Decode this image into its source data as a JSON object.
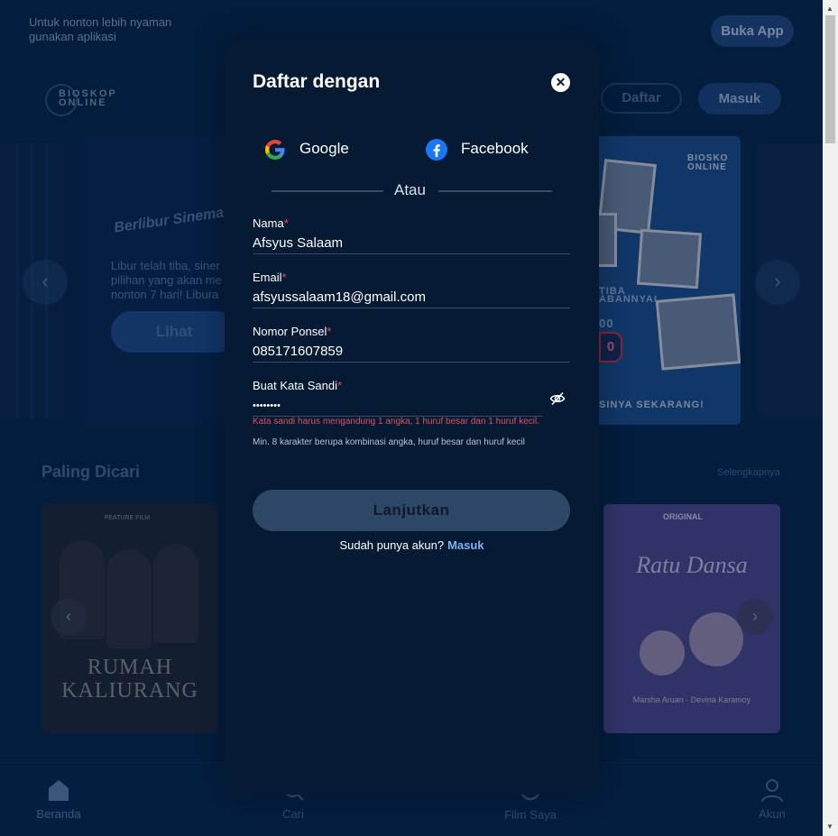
{
  "topbar": {
    "promo": "Untuk nonton lebih nyaman gunakan aplikasi",
    "open_app": "Buka App"
  },
  "header": {
    "logo_line1": "BIOSKOP",
    "logo_line2": "ONLINE",
    "register": "Daftar",
    "login": "Masuk"
  },
  "carousel": {
    "brand": "Berlibur Sinema",
    "description": "Libur telah tiba, siner pilihan yang akan me nonton 7 hari! Libura",
    "cta": "Lihat",
    "right_tag1": "TIBA",
    "right_tag2": "ABANNYAI",
    "right_footer": "SINYA SEKARANG!",
    "right_logo1": "BIOSKO",
    "right_logo2": "ONLINE",
    "right_sign": "0",
    "right_num": "00"
  },
  "section": {
    "title": "Paling Dicari",
    "more": "Selengkapnya"
  },
  "posters": [
    {
      "title": "RUMAH KALIURANG",
      "label": "FEATURE FILM"
    },
    {
      "title": "Ratu Dansa",
      "label": "ORIGINAL",
      "credits": "Marsha Aruan · Devina Karamoy"
    }
  ],
  "bottom_nav": [
    {
      "label": "Beranda",
      "icon": "home-icon",
      "active": true
    },
    {
      "label": "Cari",
      "icon": "search-icon",
      "active": false
    },
    {
      "label": "Film Saya",
      "icon": "film-icon",
      "active": false
    },
    {
      "label": "Akun",
      "icon": "user-icon",
      "active": false
    }
  ],
  "modal": {
    "title": "Daftar dengan",
    "google": "Google",
    "facebook": "Facebook",
    "or": "Atau",
    "fields": {
      "name": {
        "label": "Nama",
        "value": "Afsyus Salaam"
      },
      "email": {
        "label": "Email",
        "value": "afsyussalaam18@gmail.com"
      },
      "phone": {
        "label": "Nomor Ponsel",
        "value": "085171607859"
      },
      "password": {
        "label": "Buat Kata Sandi",
        "value": "••••••••"
      }
    },
    "required_mark": "*",
    "error": "Kata sandi harus mengandung 1 angka, 1 huruf besar dan 1 huruf kecil.",
    "hint": "Min. 8 karakter berupa kombinasi angka, huruf besar dan huruf kecil",
    "submit": "Lanjutkan",
    "have_account": "Sudah punya akun?",
    "login_link": "Masuk"
  },
  "colors": {
    "background": "#06284f",
    "modal": "#061a33",
    "error": "#e0505a",
    "link": "#7fb0f0",
    "button_disabled": "#2e4766"
  }
}
